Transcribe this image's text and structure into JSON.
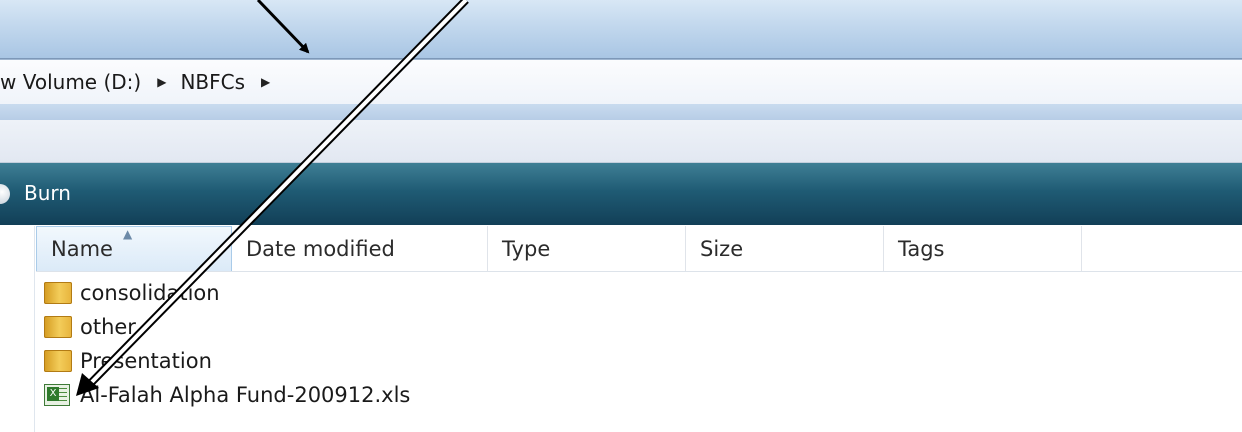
{
  "address_bar": {
    "crumbs": [
      "w Volume (D:)",
      "NBFCs"
    ],
    "separator_icon": "chevron-right-icon"
  },
  "toolbar": {
    "burn_label": "Burn"
  },
  "columns": {
    "name": "Name",
    "date_modified": "Date modified",
    "type": "Type",
    "size": "Size",
    "tags": "Tags",
    "sorted_column": "Name"
  },
  "files": [
    {
      "name": "consolidation",
      "icon": "folder-icon"
    },
    {
      "name": "other",
      "icon": "folder-icon"
    },
    {
      "name": "Presentation",
      "icon": "folder-icon"
    },
    {
      "name": "Al-Falah Alpha Fund-200912.xls",
      "icon": "excel-file-icon"
    }
  ],
  "colors": {
    "toolbar": "#1f5b74",
    "title_bar": "#c4d9ee",
    "selected_header": "#dbeaf8",
    "annotation_arrow": "#000000"
  }
}
